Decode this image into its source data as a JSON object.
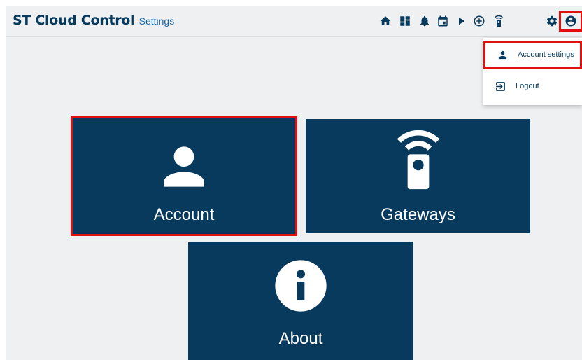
{
  "header": {
    "app_name": "ST Cloud Control",
    "separator": "-",
    "page_name": "Settings"
  },
  "toolbar_icons": [
    "home-icon",
    "dashboard-icon",
    "bell-icon",
    "calendar-icon",
    "play-icon",
    "add-circle-icon",
    "remote-icon",
    "gear-icon",
    "account-circle-icon"
  ],
  "account_menu": {
    "items": [
      {
        "label": "Account settings",
        "icon": "person-icon"
      },
      {
        "label": "Logout",
        "icon": "logout-icon"
      }
    ]
  },
  "tiles": [
    {
      "label": "Account",
      "icon": "person-icon"
    },
    {
      "label": "Gateways",
      "icon": "remote-icon"
    },
    {
      "label": "About",
      "icon": "info-icon"
    }
  ],
  "colors": {
    "tile": "#073a5c",
    "background": "#eff0f2",
    "highlight": "#e01010"
  }
}
